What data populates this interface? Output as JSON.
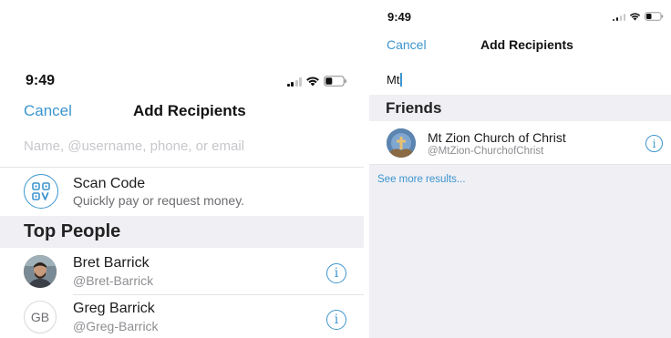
{
  "left": {
    "status": {
      "time": "9:49"
    },
    "nav": {
      "cancel": "Cancel",
      "title": "Add Recipients"
    },
    "search": {
      "placeholder": "Name, @username, phone, or email"
    },
    "scan": {
      "title": "Scan Code",
      "subtitle": "Quickly pay or request money."
    },
    "section_title": "Top People",
    "people": [
      {
        "name": "Bret Barrick",
        "handle": "@Bret-Barrick",
        "initials": ""
      },
      {
        "name": "Greg Barrick",
        "handle": "@Greg-Barrick",
        "initials": "GB"
      }
    ]
  },
  "right": {
    "status": {
      "time": "9:49"
    },
    "nav": {
      "cancel": "Cancel",
      "title": "Add Recipients"
    },
    "search": {
      "value": "Mt"
    },
    "section_title": "Friends",
    "results": [
      {
        "name": "Mt Zion Church of Christ",
        "handle": "@MtZion-ChurchofChrist"
      }
    ],
    "see_more": "See more results..."
  },
  "icons": {
    "info": "i",
    "signal": "signal-icon",
    "wifi": "wifi-icon",
    "battery": "battery-icon",
    "scan": "qr-scan-icon"
  },
  "colors": {
    "accent": "#3d95ce",
    "section_bg": "#efeff4",
    "placeholder": "#c7c7cc"
  }
}
